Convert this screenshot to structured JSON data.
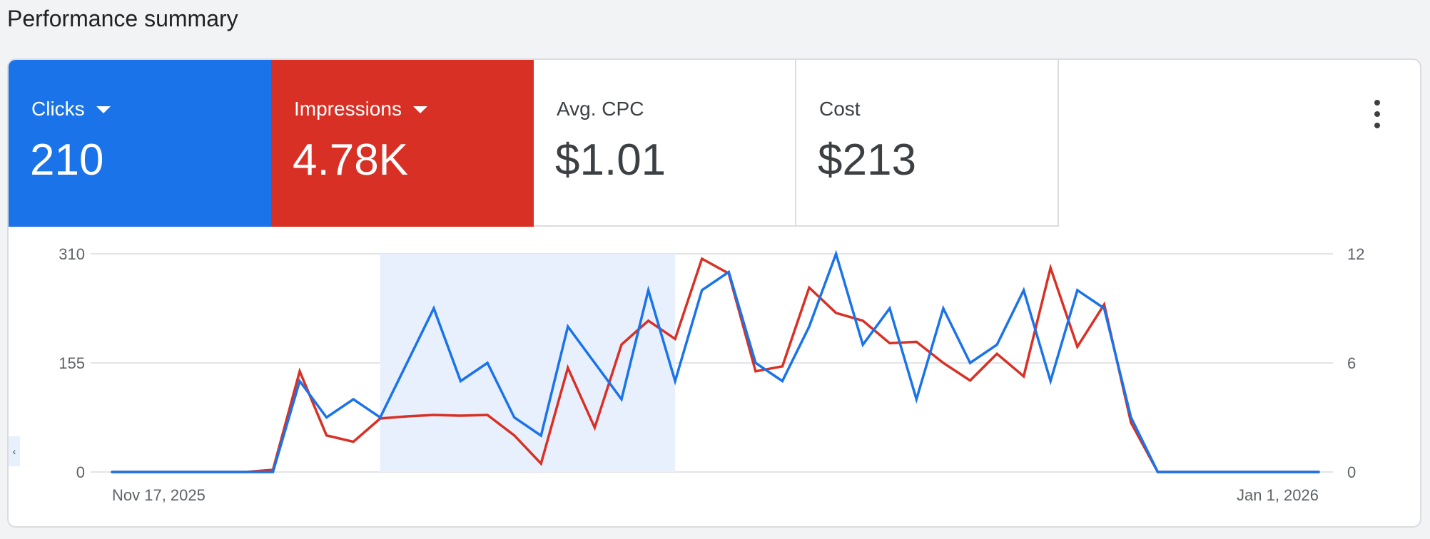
{
  "page": {
    "title": "Performance summary"
  },
  "tiles": [
    {
      "label": "Clicks",
      "value": "210",
      "color": "#1a73e8",
      "has_dropdown": true
    },
    {
      "label": "Impressions",
      "value": "4.78K",
      "color": "#d93025",
      "has_dropdown": true
    },
    {
      "label": "Avg. CPC",
      "value": "$1.01",
      "has_dropdown": false
    },
    {
      "label": "Cost",
      "value": "$213",
      "has_dropdown": false
    }
  ],
  "menu": {
    "icon": "more-vert-icon"
  },
  "chart_data": {
    "type": "line",
    "y_left": {
      "ticks": [
        "0",
        "155",
        "310"
      ],
      "range": [
        0,
        310
      ]
    },
    "y_right": {
      "ticks": [
        "0",
        "6",
        "12"
      ],
      "range": [
        0,
        12
      ]
    },
    "x_start_label": "Nov 17, 2025",
    "x_end_label": "Jan 1, 2026",
    "highlight_range": [
      10,
      21
    ],
    "grid": true,
    "series": [
      {
        "color": "#d93025",
        "axis": "left",
        "values": [
          0,
          0,
          0,
          0,
          0,
          0,
          3,
          143,
          52,
          43,
          76,
          79,
          81,
          80,
          81,
          52,
          12,
          148,
          63,
          181,
          215,
          189,
          303,
          282,
          143,
          150,
          262,
          226,
          215,
          183,
          185,
          155,
          130,
          168,
          136,
          290,
          178,
          238,
          70,
          0,
          0,
          0,
          0,
          0,
          0,
          0
        ]
      },
      {
        "color": "#1a73e8",
        "axis": "right",
        "values": [
          0,
          0,
          0,
          0,
          0,
          0,
          0,
          5,
          3,
          4,
          3,
          6,
          9,
          5,
          6,
          3,
          2,
          8,
          6,
          4,
          10,
          5,
          10,
          11,
          6,
          5,
          8,
          12,
          7,
          9,
          4,
          9,
          6,
          7,
          10,
          5,
          10,
          9,
          3,
          0,
          0,
          0,
          0,
          0,
          0,
          0
        ]
      }
    ]
  }
}
